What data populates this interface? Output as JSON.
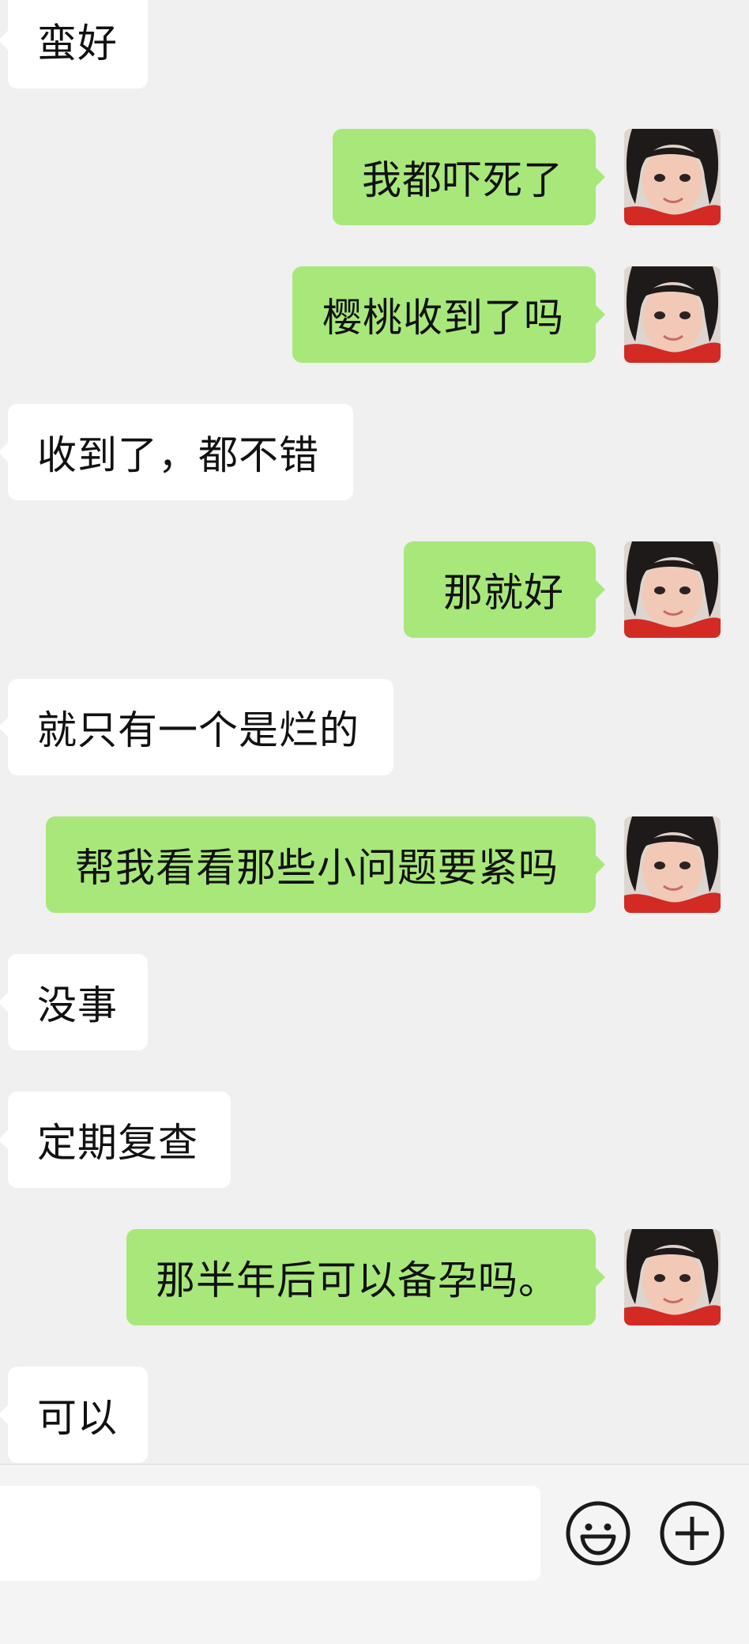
{
  "messages": [
    {
      "side": "in",
      "text": "蛮好"
    },
    {
      "side": "out",
      "text": "我都吓死了"
    },
    {
      "side": "out",
      "text": "樱桃收到了吗"
    },
    {
      "side": "in",
      "text": "收到了，都不错"
    },
    {
      "side": "out",
      "text": "那就好"
    },
    {
      "side": "in",
      "text": "就只有一个是烂的"
    },
    {
      "side": "out",
      "text": "帮我看看那些小问题要紧吗"
    },
    {
      "side": "in",
      "text": "没事"
    },
    {
      "side": "in",
      "text": "定期复查"
    },
    {
      "side": "out",
      "text": "那半年后可以备孕吗。"
    },
    {
      "side": "in",
      "text": "可以"
    }
  ],
  "input": {
    "value": ""
  },
  "icons": {
    "emoji": "smiley-icon",
    "more": "plus-circle-icon"
  },
  "colors": {
    "outgoing_bubble": "#a8e87a",
    "incoming_bubble": "#ffffff",
    "background": "#f0f0f0"
  }
}
